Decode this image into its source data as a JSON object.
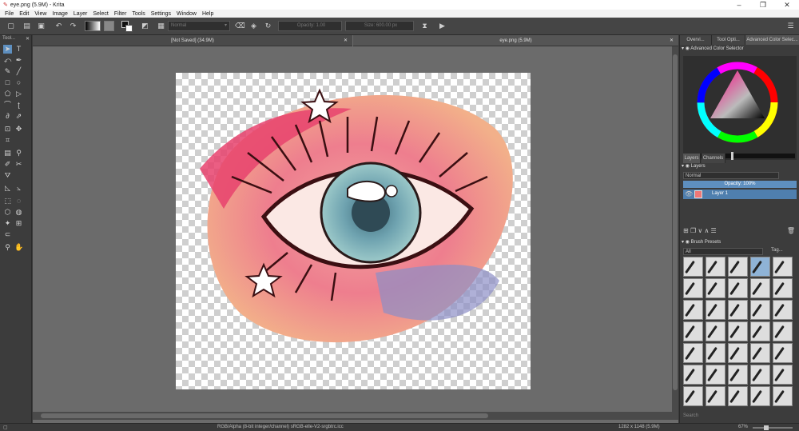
{
  "window": {
    "title": "eye.png (5.9M) - Krita",
    "controls": [
      "–",
      "❐",
      "✕"
    ]
  },
  "menu": [
    "File",
    "Edit",
    "View",
    "Image",
    "Layer",
    "Select",
    "Filter",
    "Tools",
    "Settings",
    "Window",
    "Help"
  ],
  "toolbar": {
    "blend_mode": "Normal",
    "opacity_label": "Opacity: 1.00",
    "size_label": "Size: 600.00 px"
  },
  "toolbox": {
    "title": "Tool...",
    "close": "✕"
  },
  "documents": {
    "tab1": "[Not Saved]  (34.9M)",
    "tab2": "eye.png (5.9M)",
    "close": "✕"
  },
  "dock": {
    "tabs": [
      "Overvi...",
      "Tool Opti...",
      "Advanced Color Selec..."
    ],
    "color_selector_title": "Advanced Color Selector",
    "layers_tabs": [
      "Layers",
      "Channels"
    ],
    "layers_title": "Layers",
    "layers_blend": "Normal",
    "layers_opacity": "Opacity:  100%",
    "layer_name": "Layer 1",
    "brush_title": "Brush Presets",
    "brush_filter": "All",
    "brush_tag": "Tag...",
    "search_placeholder": "Search"
  },
  "status": {
    "color_info": "RGB/Alpha (8-bit integer/channel)  sRGB-elle-V2-srgbtrc.icc",
    "dimensions": "1282 x 1148 (5.9M)",
    "zoom": "67%"
  },
  "colors": {
    "accent": "#5e8fbf",
    "selected_layer": "#4f7fae",
    "canvas_bg": "#6b6b6b"
  }
}
